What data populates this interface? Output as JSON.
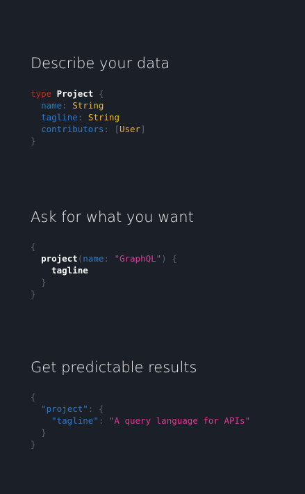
{
  "sections": [
    {
      "heading": "Describe your data",
      "code": {
        "keyword": "type",
        "type_name": "Project",
        "open_brace": "{",
        "close_brace": "}",
        "fields": [
          {
            "name": "name",
            "colon": ":",
            "type": "String"
          },
          {
            "name": "tagline",
            "colon": ":",
            "type": "String"
          },
          {
            "name": "contributors",
            "colon": ":",
            "open_bracket": "[",
            "type": "User",
            "close_bracket": "]"
          }
        ]
      }
    },
    {
      "heading": "Ask for what you want",
      "code": {
        "open_brace": "{",
        "close_brace": "}",
        "field": "project",
        "open_paren": "(",
        "arg_name": "name",
        "colon": ":",
        "arg_value": "\"GraphQL\"",
        "close_paren": ")",
        "inner_open_brace": "{",
        "inner_field": "tagline",
        "inner_close_brace": "}"
      }
    },
    {
      "heading": "Get predictable results",
      "code": {
        "open_brace": "{",
        "close_brace": "}",
        "key1": "\"project\"",
        "colon1": ":",
        "inner_open_brace": "{",
        "key2": "\"tagline\"",
        "colon2": ":",
        "value2": "\"A query language for APIs\"",
        "inner_close_brace": "}"
      }
    }
  ],
  "colors": {
    "background": "#1b1f27",
    "heading": "#f0f0f0",
    "punctuation": "#5c6370",
    "keyword": "#b5321f",
    "field": "#2f7ac6",
    "type": "#e7b62c",
    "string": "#e2389a"
  }
}
